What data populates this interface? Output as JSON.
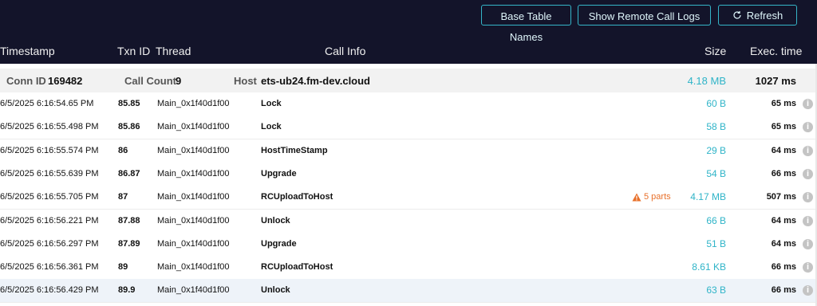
{
  "toolbar": {
    "base_table_names": "Base Table Names",
    "show_remote_call_logs": "Show Remote Call Logs",
    "refresh": "Refresh"
  },
  "columns": {
    "timestamp": "Timestamp",
    "txn_id": "Txn ID",
    "thread": "Thread",
    "call_info": "Call Info",
    "size": "Size",
    "exec_time": "Exec. time"
  },
  "connection": {
    "conn_id_label": "Conn ID",
    "conn_id": "169482",
    "call_count_label": "Call Count",
    "call_count": "9",
    "host_label": "Host",
    "host": "ets-ub24.fm-dev.cloud",
    "size": "4.18 MB",
    "exec_time": "1027 ms"
  },
  "rows": [
    {
      "timestamp": "6/5/2025 6:16:54.65 PM",
      "txn": "85.85",
      "thread": "Main_0x1f40d1f00",
      "call": "Lock",
      "size": "60 B",
      "exec": "65 ms"
    },
    {
      "timestamp": "6/5/2025 6:16:55.498 PM",
      "txn": "85.86",
      "thread": "Main_0x1f40d1f00",
      "call": "Lock",
      "size": "58 B",
      "exec": "65 ms"
    },
    {
      "timestamp": "6/5/2025 6:16:55.574 PM",
      "txn": "86",
      "thread": "Main_0x1f40d1f00",
      "call": "HostTimeStamp",
      "size": "29 B",
      "exec": "64 ms"
    },
    {
      "timestamp": "6/5/2025 6:16:55.639 PM",
      "txn": "86.87",
      "thread": "Main_0x1f40d1f00",
      "call": "Upgrade",
      "size": "54 B",
      "exec": "66 ms"
    },
    {
      "timestamp": "6/5/2025 6:16:55.705 PM",
      "txn": "87",
      "thread": "Main_0x1f40d1f00",
      "call": "RCUploadToHost",
      "size": "4.17 MB",
      "exec": "507 ms",
      "warning": "5 parts"
    },
    {
      "timestamp": "6/5/2025 6:16:56.221 PM",
      "txn": "87.88",
      "thread": "Main_0x1f40d1f00",
      "call": "Unlock",
      "size": "66 B",
      "exec": "64 ms"
    },
    {
      "timestamp": "6/5/2025 6:16:56.297 PM",
      "txn": "87.89",
      "thread": "Main_0x1f40d1f00",
      "call": "Upgrade",
      "size": "51 B",
      "exec": "64 ms"
    },
    {
      "timestamp": "6/5/2025 6:16:56.361 PM",
      "txn": "89",
      "thread": "Main_0x1f40d1f00",
      "call": "RCUploadToHost",
      "size": "8.61 KB",
      "exec": "66 ms"
    },
    {
      "timestamp": "6/5/2025 6:16:56.429 PM",
      "txn": "89.9",
      "thread": "Main_0x1f40d1f00",
      "call": "Unlock",
      "size": "63 B",
      "exec": "66 ms",
      "selected": true
    }
  ],
  "colors": {
    "header_bg": "#13142a",
    "accent": "#2fb4c8",
    "warning": "#e8702a"
  },
  "icons": {
    "refresh": "refresh-icon",
    "info": "info-icon",
    "warning": "warning-icon"
  }
}
